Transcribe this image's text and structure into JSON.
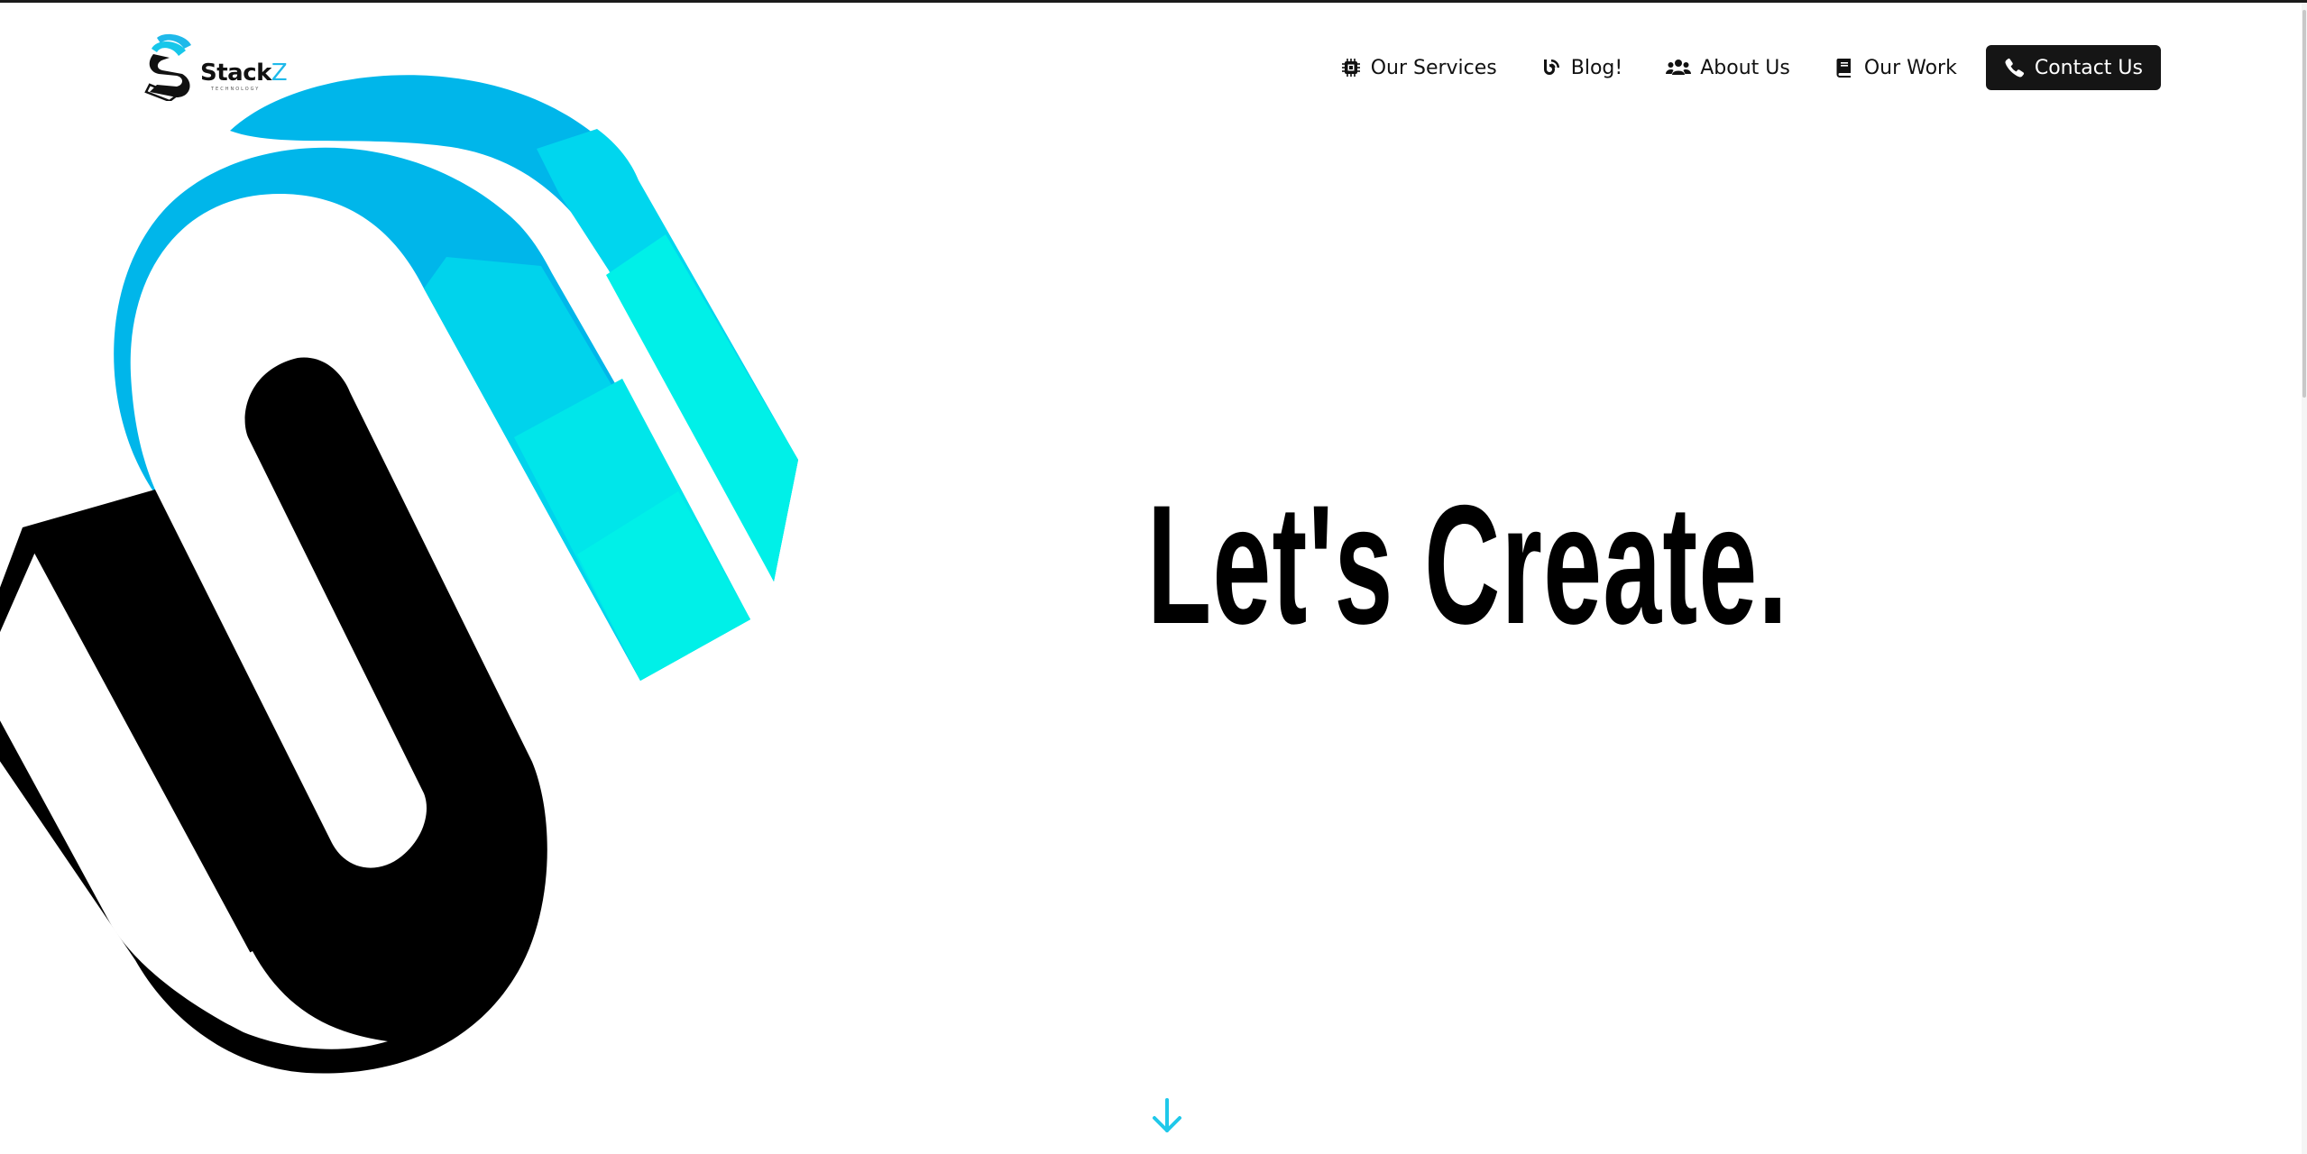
{
  "brand": {
    "name_main": "Stack",
    "name_accent": "Z",
    "tagline": "TECHNOLOGY",
    "accent_color": "#1fb9ea"
  },
  "nav": {
    "items": [
      {
        "label": "Our Services",
        "icon": "chip-icon"
      },
      {
        "label": "Blog!",
        "icon": "blog-icon"
      },
      {
        "label": "About Us",
        "icon": "users-icon"
      },
      {
        "label": "Our Work",
        "icon": "book-icon"
      }
    ],
    "contact": {
      "label": "Contact Us",
      "icon": "phone-icon"
    }
  },
  "hero": {
    "headline": "Let's Create.",
    "scroll_icon": "arrow-down-icon"
  },
  "colors": {
    "cyan_light": "#00f0e8",
    "cyan_mid": "#00d9ec",
    "blue": "#00b6ea",
    "black": "#000000",
    "contact_bg": "#151515"
  }
}
